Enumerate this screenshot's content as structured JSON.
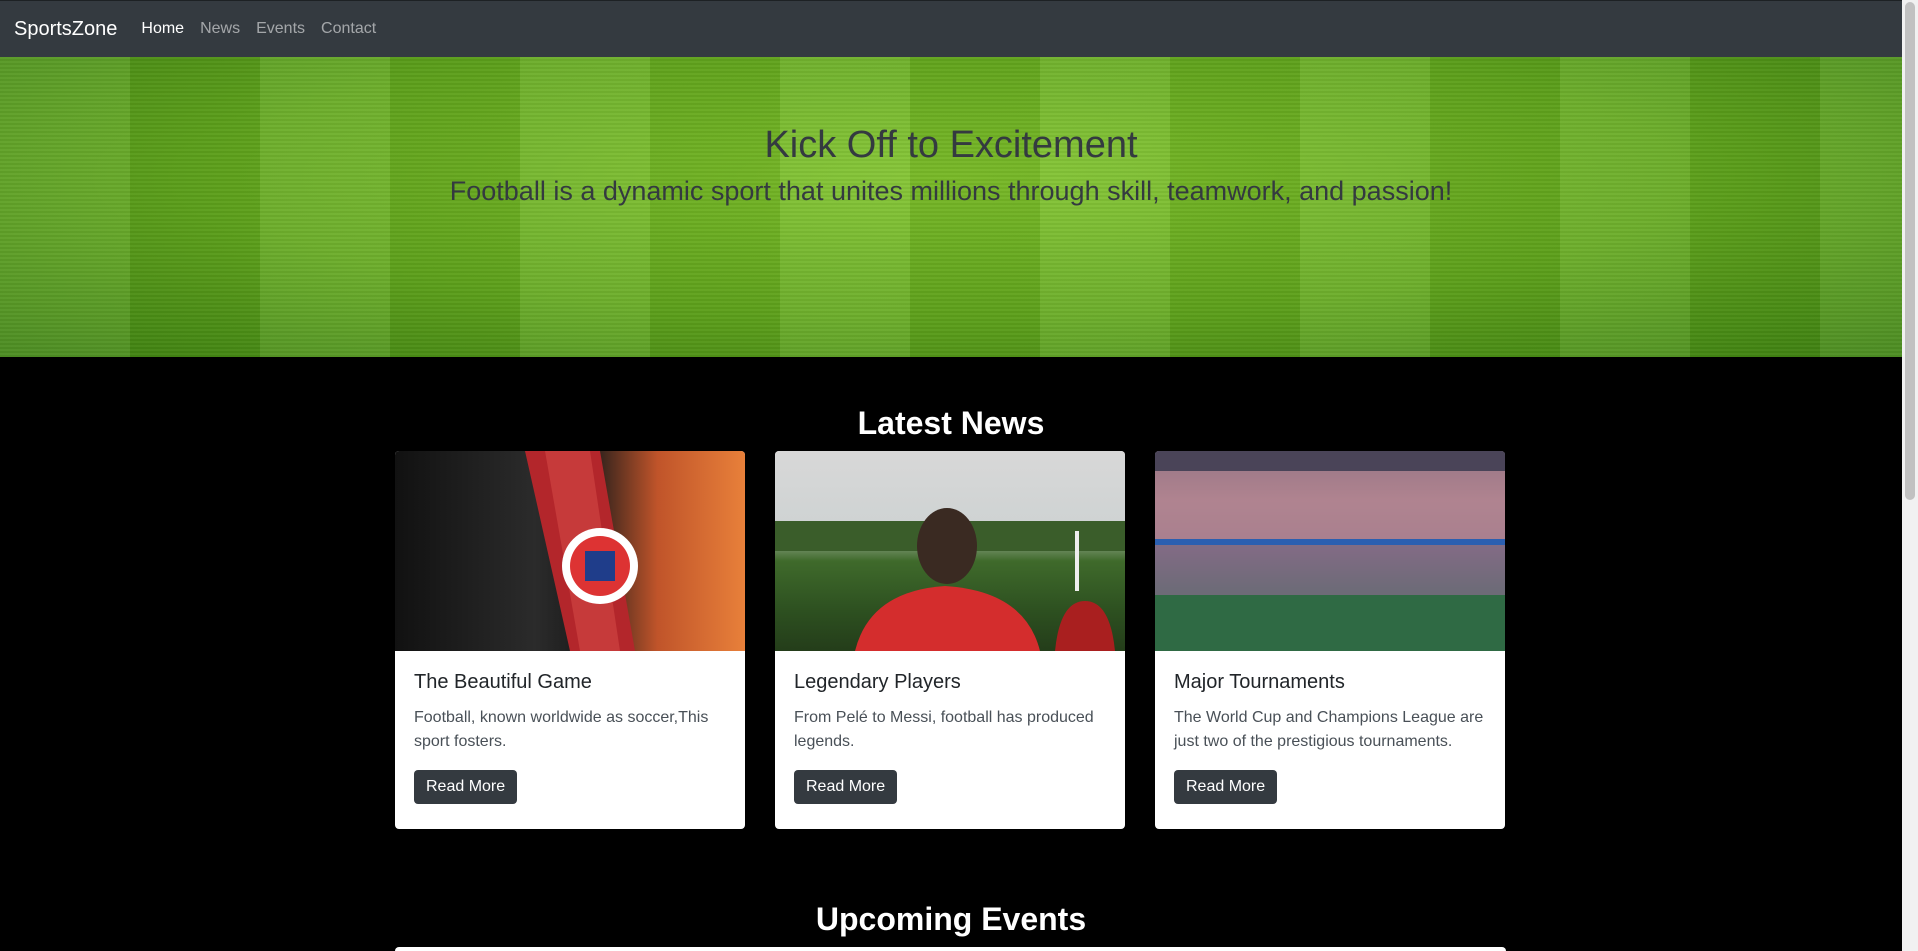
{
  "navbar": {
    "brand": "SportsZone",
    "links": [
      "Home",
      "News",
      "Events",
      "Contact"
    ]
  },
  "hero": {
    "title": "Kick Off to Excitement",
    "subtitle": "Football is a dynamic sport that unites millions through skill, teamwork, and passion!"
  },
  "news": {
    "heading": "Latest News",
    "cards": [
      {
        "title": "The Beautiful Game",
        "text": "Football, known worldwide as soccer,This sport fosters.",
        "button": "Read More"
      },
      {
        "title": "Legendary Players",
        "text": "From Pelé to Messi, football has produced legends.",
        "button": "Read More"
      },
      {
        "title": "Major Tournaments",
        "text": "The World Cup and Champions League are just two of the prestigious tournaments.",
        "button": "Read More"
      }
    ]
  },
  "events": {
    "heading": "Upcoming Events"
  }
}
